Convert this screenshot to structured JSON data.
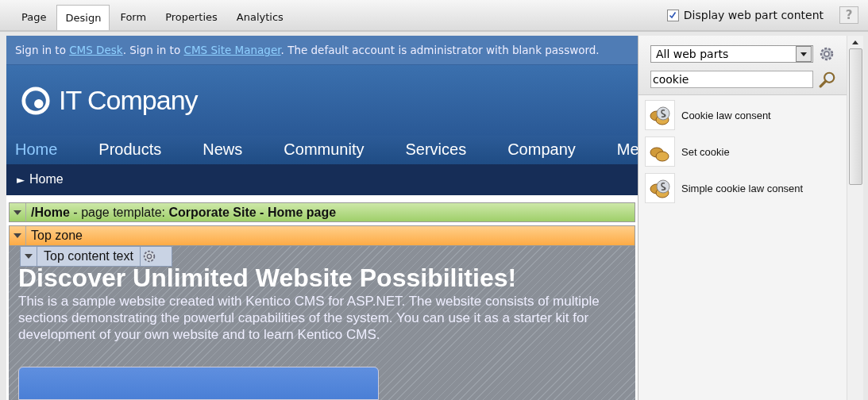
{
  "tabs": [
    {
      "label": "Page",
      "selected": false
    },
    {
      "label": "Design",
      "selected": true
    },
    {
      "label": "Form",
      "selected": false
    },
    {
      "label": "Properties",
      "selected": false
    },
    {
      "label": "Analytics",
      "selected": false
    }
  ],
  "display_toggle": {
    "label": "Display web part content",
    "checked": true
  },
  "help_button": "?",
  "signin_bar": {
    "parts": [
      {
        "kind": "text",
        "text": "Sign in to "
      },
      {
        "kind": "link",
        "text": "CMS Desk"
      },
      {
        "kind": "text",
        "text": ". Sign in to "
      },
      {
        "kind": "link",
        "text": "CMS Site Manager"
      },
      {
        "kind": "text",
        "text": ". The default account is administrator with blank password."
      }
    ]
  },
  "site_logo": "IT Company",
  "nav": [
    {
      "label": "Home",
      "selected": true
    },
    {
      "label": "Products",
      "selected": false
    },
    {
      "label": "News",
      "selected": false
    },
    {
      "label": "Community",
      "selected": false
    },
    {
      "label": "Services",
      "selected": false
    },
    {
      "label": "Company",
      "selected": false
    },
    {
      "label": "Me",
      "selected": false
    }
  ],
  "breadcrumb": {
    "marker": "►",
    "label": "Home"
  },
  "template_bar": "**/Home** - page template: **Corporate Site - Home page**",
  "zone_bar": "Top zone",
  "webpart_label": "Top content text",
  "hero": {
    "title": "Discover Unlimited Website Possibilities!",
    "text": "This is a sample website created with Kentico CMS for ASP.NET. The website consists of multiple sections demonstrating the powerful capabilities of the system. You can use it as a starter kit for development of your own website and to learn Kentico CMS."
  },
  "panel": {
    "category": "All web parts",
    "search": "cookie",
    "results": [
      {
        "label": "Cookie law consent",
        "kind": "law"
      },
      {
        "label": "Set cookie",
        "kind": "cookie"
      },
      {
        "label": "Simple cookie law consent",
        "kind": "law"
      }
    ]
  }
}
